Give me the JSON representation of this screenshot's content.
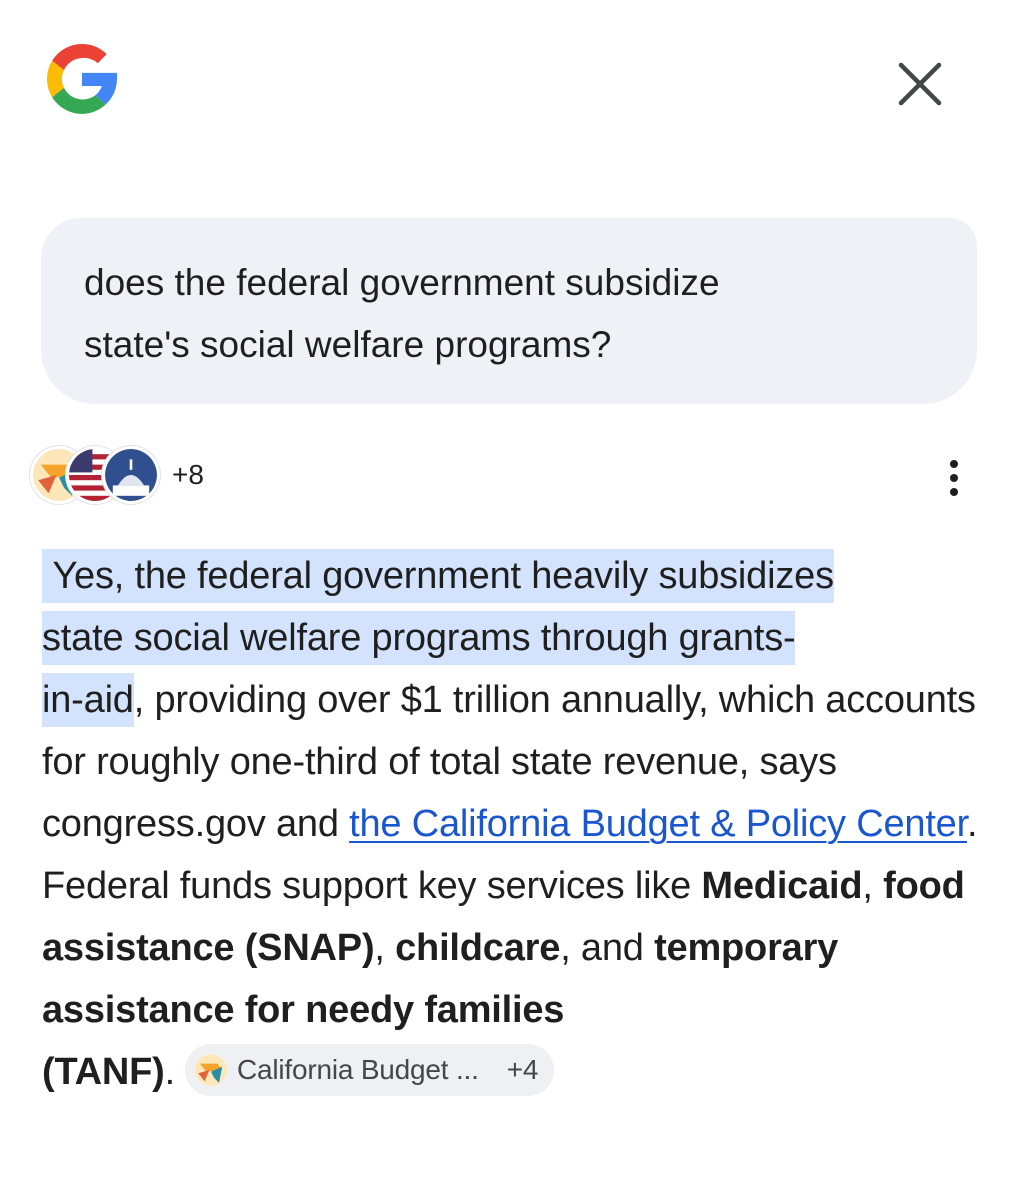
{
  "header": {
    "logo_icon": "google-g-icon",
    "close_icon": "close-icon"
  },
  "query": {
    "line1": "does the federal government subsidize",
    "line2": "state's social welfare programs?"
  },
  "sources": {
    "icons": [
      "california-budget-logo-icon",
      "us-flag-icon",
      "capitol-dome-icon"
    ],
    "more_count": "+8",
    "menu_icon": "more-vert-icon"
  },
  "answer": {
    "highlight_1": "Yes, the federal government heavily subsidizes",
    "highlight_2": "state social welfare programs through grants-",
    "highlight_3": "in-aid",
    "text_1": ", providing over $1 trillion annually, which accounts for roughly one-third of total state revenue, says congress.gov and ",
    "link": "the California Budget & Policy Center",
    "text_2": ". Federal funds support key services like ",
    "bold_1": "Medicaid",
    "text_3": ", ",
    "bold_2": "food assistance (SNAP)",
    "text_4": ", ",
    "bold_3": "childcare",
    "text_5": ", and ",
    "bold_4": "temporary assistance for needy families",
    "bold_5": "(TANF)",
    "text_6": "."
  },
  "citation_chip": {
    "label": "California Budget ...",
    "more": "+4"
  },
  "colors": {
    "highlight": "#d3e3fd",
    "link": "#1a56cf",
    "bubble": "#eef1f6"
  }
}
